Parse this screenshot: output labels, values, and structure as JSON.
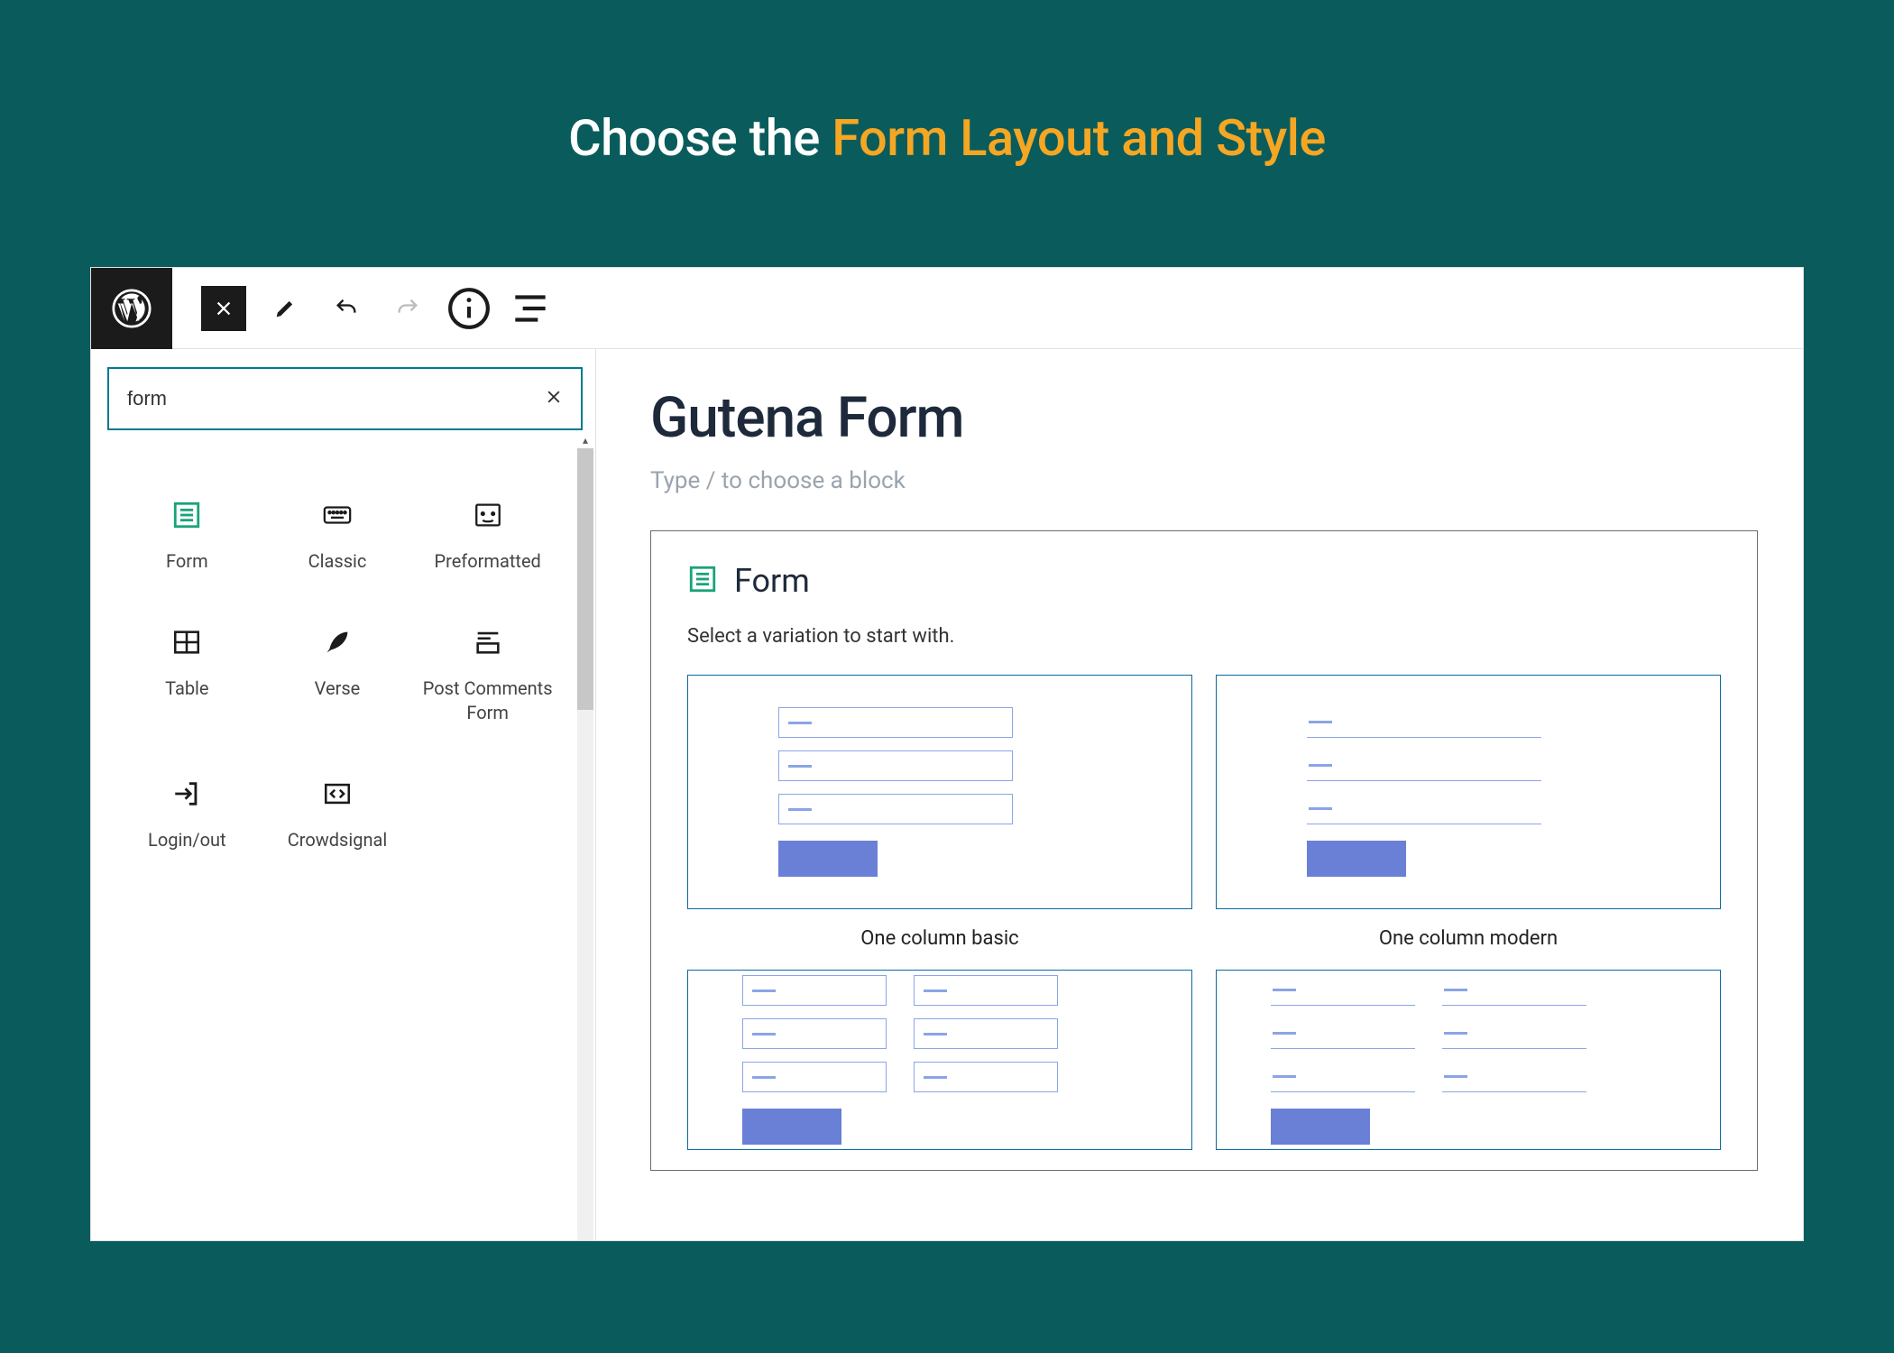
{
  "headline": {
    "prefix": "Choose the ",
    "accent": "Form Layout and Style"
  },
  "search": {
    "value": "form"
  },
  "blocks": [
    {
      "label": "Form"
    },
    {
      "label": "Classic"
    },
    {
      "label": "Preformatted"
    },
    {
      "label": "Table"
    },
    {
      "label": "Verse"
    },
    {
      "label": "Post Comments Form"
    },
    {
      "label": "Login/out"
    },
    {
      "label": "Crowdsignal"
    }
  ],
  "document": {
    "title": "Gutena Form",
    "placeholder": "Type / to choose a block"
  },
  "form_block": {
    "title": "Form",
    "subtitle": "Select a variation to start with.",
    "variations": [
      {
        "label": "One column basic"
      },
      {
        "label": "One column modern"
      }
    ]
  }
}
